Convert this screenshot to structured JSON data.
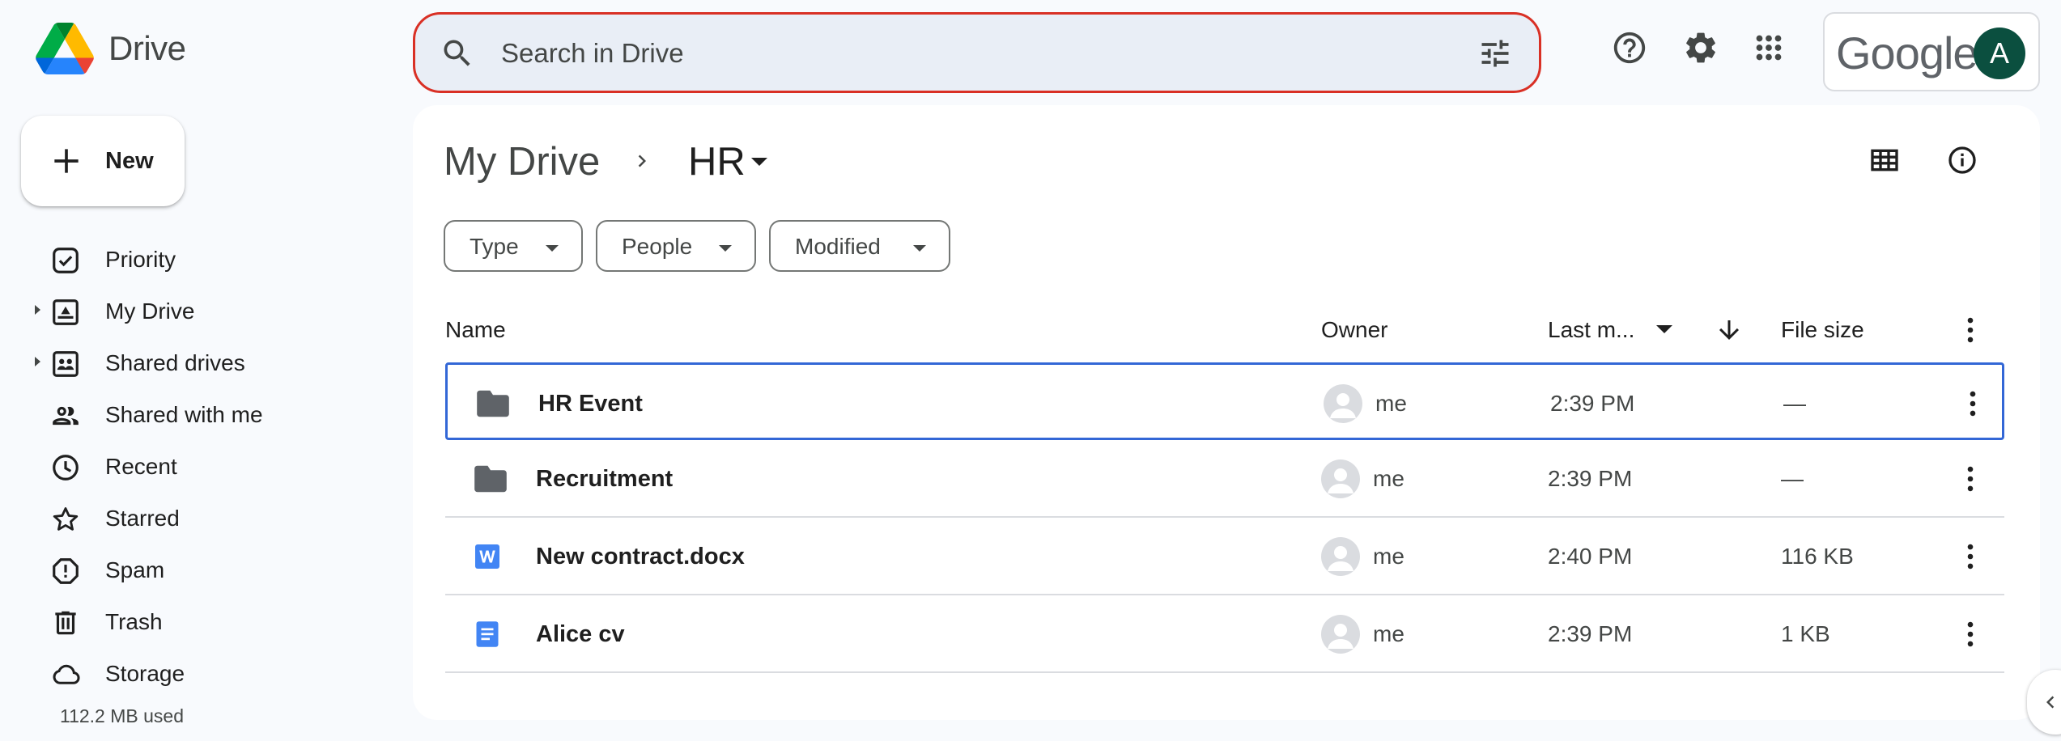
{
  "app": {
    "name": "Drive"
  },
  "search": {
    "placeholder": "Search in Drive",
    "value": ""
  },
  "account": {
    "brand": "Google",
    "avatar_letter": "A",
    "avatar_color": "#0b4f3f"
  },
  "sidebar": {
    "new_label": "New",
    "items": [
      {
        "label": "Priority",
        "icon": "priority-icon",
        "expandable": false
      },
      {
        "label": "My Drive",
        "icon": "my-drive-icon",
        "expandable": true
      },
      {
        "label": "Shared drives",
        "icon": "shared-drives-icon",
        "expandable": true
      },
      {
        "label": "Shared with me",
        "icon": "people-icon",
        "expandable": false
      },
      {
        "label": "Recent",
        "icon": "clock-icon",
        "expandable": false
      },
      {
        "label": "Starred",
        "icon": "star-icon",
        "expandable": false
      },
      {
        "label": "Spam",
        "icon": "spam-icon",
        "expandable": false
      },
      {
        "label": "Trash",
        "icon": "trash-icon",
        "expandable": false
      },
      {
        "label": "Storage",
        "icon": "cloud-icon",
        "expandable": false
      }
    ],
    "storage_used": "112.2 MB used"
  },
  "breadcrumb": {
    "root": "My Drive",
    "current": "HR"
  },
  "filters": {
    "type": "Type",
    "people": "People",
    "modified": "Modified"
  },
  "table": {
    "headers": {
      "name": "Name",
      "owner": "Owner",
      "modified": "Last m...",
      "size": "File size"
    },
    "rows": [
      {
        "name": "HR Event",
        "kind": "folder",
        "owner": "me",
        "modified": "2:39 PM",
        "size": "—",
        "selected": true
      },
      {
        "name": "Recruitment",
        "kind": "folder",
        "owner": "me",
        "modified": "2:39 PM",
        "size": "—",
        "selected": false
      },
      {
        "name": "New contract.docx",
        "kind": "word",
        "owner": "me",
        "modified": "2:40 PM",
        "size": "116 KB",
        "selected": false
      },
      {
        "name": "Alice cv",
        "kind": "doc",
        "owner": "me",
        "modified": "2:39 PM",
        "size": "1 KB",
        "selected": false
      }
    ]
  },
  "colors": {
    "accent": "#0b57d0",
    "selection": "#3367d6",
    "search_border": "#d93025",
    "search_bg": "#e9eef6",
    "folder": "#5f6368",
    "doc_blue": "#4285f4"
  }
}
